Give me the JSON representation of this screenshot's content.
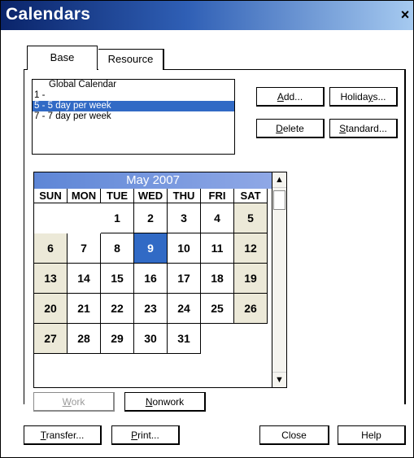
{
  "window": {
    "title": "Calendars",
    "close_glyph": "×"
  },
  "tabs": [
    {
      "label": "Base"
    },
    {
      "label": "Resource"
    }
  ],
  "calendar_list": [
    {
      "label": "Global Calendar"
    },
    {
      "label": "1 -"
    },
    {
      "label": "5 - 5 day per week"
    },
    {
      "label": "7 - 7 day per week"
    }
  ],
  "side_buttons": {
    "add": {
      "label": "Add...",
      "mnemonic": "A",
      "rest": "dd..."
    },
    "holidays": {
      "label": "Holidays...",
      "before": "Holida",
      "mnemonic": "y",
      "rest": "s..."
    },
    "delete": {
      "label": "Delete",
      "mnemonic": "D",
      "rest": "elete"
    },
    "standard": {
      "label": "Standard...",
      "mnemonic": "S",
      "rest": "tandard..."
    }
  },
  "calendar": {
    "month_label": "May  2007",
    "days_of_week": [
      "SUN",
      "MON",
      "TUE",
      "WED",
      "THU",
      "FRI",
      "SAT"
    ],
    "weeks": [
      [
        "",
        "",
        "1",
        "2",
        "3",
        "4",
        "5"
      ],
      [
        "6",
        "7",
        "8",
        "9",
        "10",
        "11",
        "12"
      ],
      [
        "13",
        "14",
        "15",
        "16",
        "17",
        "18",
        "19"
      ],
      [
        "20",
        "21",
        "22",
        "23",
        "24",
        "25",
        "26"
      ],
      [
        "27",
        "28",
        "29",
        "30",
        "31",
        "",
        ""
      ]
    ],
    "selected_day": "9"
  },
  "scrollbar": {
    "up_glyph": "▲",
    "down_glyph": "▼"
  },
  "work_buttons": {
    "work": {
      "label": "Work",
      "mnemonic": "W",
      "rest": "ork"
    },
    "nonwork": {
      "label": "Nonwork",
      "mnemonic": "N",
      "rest": "onwork"
    }
  },
  "footer_buttons": {
    "transfer": {
      "label": "Transfer...",
      "mnemonic": "T",
      "rest": "ransfer..."
    },
    "print": {
      "label": "Print...",
      "mnemonic": "P",
      "rest": "rint..."
    },
    "close": {
      "label": "Close"
    },
    "help": {
      "label": "Help"
    }
  },
  "colors": {
    "title_start": "#0a246a",
    "title_end": "#a6caf0",
    "selection": "#316ac5",
    "weekend": "#ece9d8"
  }
}
